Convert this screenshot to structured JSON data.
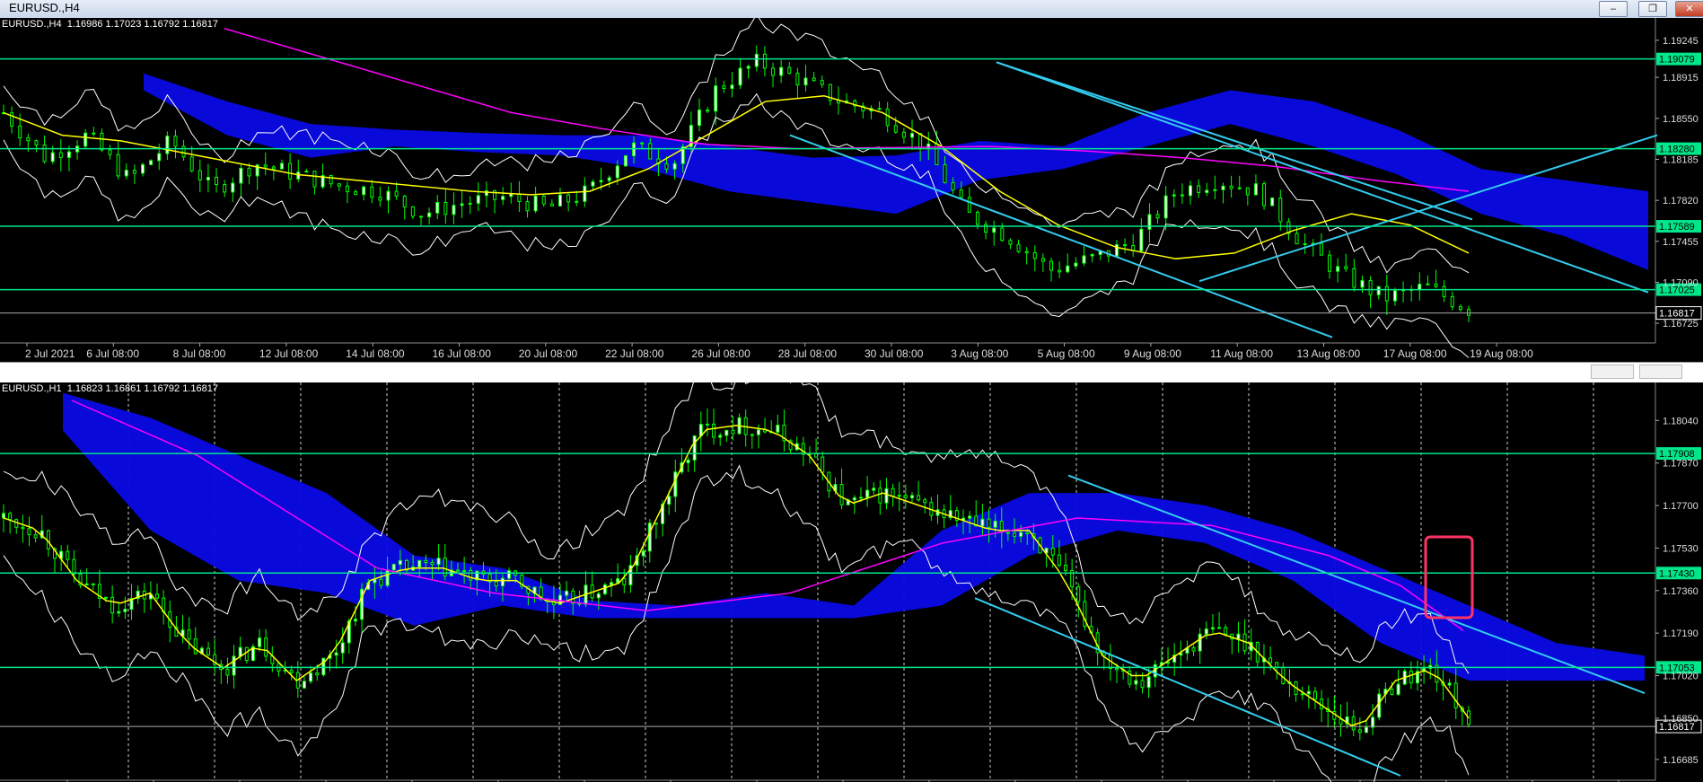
{
  "window": {
    "title": "EURUSD.,H4",
    "controls": {
      "minimize": "–",
      "restore": "❐",
      "close": "✕"
    }
  },
  "colors": {
    "background": "#000000",
    "bull_candle": "#ffffff",
    "candle": "#00ff00",
    "level_line": "#00e68a",
    "channel": "#33ccee",
    "cloud": "#0a0ae6",
    "ma_fast": "#ffff00",
    "ma_slow": "#ff00ff",
    "bollinger": "#ffffff",
    "highlight_box": "#ff3366",
    "price_tag": "#00e68a"
  },
  "panes": [
    {
      "symbol_header": "EURUSD.,H4  1.16986 1.17023 1.16792 1.16817",
      "price_scale": [
        "1.19245",
        "1.18915",
        "1.18550",
        "1.18185",
        "1.17820",
        "1.17455",
        "1.17090",
        "1.16725"
      ],
      "level_tags": [
        "1.19079",
        "1.18280",
        "1.17589",
        "1.17025"
      ],
      "current_price": "1.16817",
      "time_labels": [
        "2 Jul 2021",
        "6 Jul 08:00",
        "8 Jul 08:00",
        "12 Jul 08:00",
        "14 Jul 08:00",
        "16 Jul 08:00",
        "20 Jul 08:00",
        "22 Jul 08:00",
        "26 Jul 08:00",
        "28 Jul 08:00",
        "30 Jul 08:00",
        "3 Aug 08:00",
        "5 Aug 08:00",
        "9 Aug 08:00",
        "11 Aug 08:00",
        "13 Aug 08:00",
        "17 Aug 08:00",
        "19 Aug 08:00"
      ]
    },
    {
      "symbol_header": "EURUSD.,H1  1.16823 1.16861 1.16792 1.16817",
      "price_scale": [
        "1.18040",
        "1.17870",
        "1.17700",
        "1.17530",
        "1.17360",
        "1.17190",
        "1.17020",
        "1.16850",
        "1.16685"
      ],
      "level_tags": [
        "1.17908",
        "1.17430",
        "1.17053"
      ],
      "current_price": "1.16817"
    }
  ],
  "chart_data": [
    {
      "type": "candlestick",
      "timeframe": "H4",
      "x": [
        "2 Jul 2021",
        "6 Jul 08:00",
        "8 Jul 08:00",
        "12 Jul 08:00",
        "14 Jul 08:00",
        "16 Jul 08:00",
        "20 Jul 08:00",
        "22 Jul 08:00",
        "26 Jul 08:00",
        "28 Jul 08:00",
        "30 Jul 08:00",
        "3 Aug 08:00",
        "5 Aug 08:00",
        "9 Aug 08:00",
        "11 Aug 08:00",
        "13 Aug 08:00",
        "17 Aug 08:00",
        "19 Aug 08:00"
      ],
      "ylim": [
        1.1655,
        1.193
      ],
      "close_path": [
        1.186,
        1.182,
        1.184,
        1.18,
        1.1835,
        1.179,
        1.1815,
        1.1805,
        1.1795,
        1.179,
        1.177,
        1.178,
        1.1785,
        1.1775,
        1.179,
        1.183,
        1.1815,
        1.188,
        1.1905,
        1.189,
        1.187,
        1.186,
        1.183,
        1.177,
        1.175,
        1.172,
        1.173,
        1.1745,
        1.179,
        1.18,
        1.179,
        1.1745,
        1.1715,
        1.1695,
        1.1705,
        1.1685
      ],
      "horizontal_levels": [
        1.19079,
        1.1828,
        1.17589,
        1.17025
      ],
      "current_price": 1.16817,
      "ma_fast_path": [
        1.186,
        1.184,
        1.1835,
        1.1825,
        1.1815,
        1.1805,
        1.18,
        1.1795,
        1.179,
        1.1787,
        1.179,
        1.181,
        1.184,
        1.187,
        1.1875,
        1.186,
        1.183,
        1.179,
        1.176,
        1.174,
        1.173,
        1.1735,
        1.1755,
        1.177,
        1.176,
        1.1735
      ],
      "ma_slow_path": [
        1.1935,
        1.191,
        1.1885,
        1.186,
        1.1845,
        1.1832,
        1.1828,
        1.1829,
        1.183,
        1.1826,
        1.182,
        1.1812,
        1.18,
        1.179
      ]
    },
    {
      "type": "candlestick",
      "timeframe": "H1",
      "ylim": [
        1.1662,
        1.1812
      ],
      "close_path": [
        1.1765,
        1.176,
        1.174,
        1.173,
        1.1735,
        1.1715,
        1.1705,
        1.1715,
        1.17,
        1.171,
        1.174,
        1.1745,
        1.1745,
        1.174,
        1.174,
        1.173,
        1.1735,
        1.174,
        1.177,
        1.18,
        1.1802,
        1.18,
        1.179,
        1.177,
        1.1775,
        1.177,
        1.1765,
        1.176,
        1.176,
        1.174,
        1.171,
        1.17,
        1.171,
        1.172,
        1.1715,
        1.17,
        1.169,
        1.168,
        1.17,
        1.1705,
        1.1685
      ],
      "horizontal_levels": [
        1.17908,
        1.1743,
        1.17053
      ],
      "current_price": 1.16817
    }
  ]
}
